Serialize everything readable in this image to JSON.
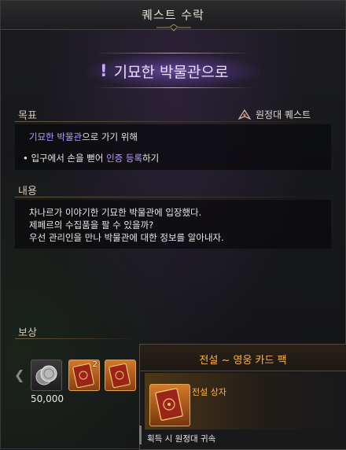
{
  "window": {
    "title": "퀘스트 수락"
  },
  "banner": {
    "title": "기묘한 박물관으로"
  },
  "objective": {
    "label": "목표",
    "quest_type": "원정대 퀘스트",
    "line1_hl": "기묘한 박물관",
    "line1_rest": "으로 가기 위해",
    "line2_pre": "입구에서 손을 뻗어 ",
    "line2_hl": "인증 등록",
    "line2_post": "하기"
  },
  "content": {
    "label": "내용",
    "lines": [
      "차나르가 이야기한 기묘한 박물관에 입장했다.",
      "제페르의 수집품을 팔 수 있을까?",
      "우선 관리인을 만나 박물관에 대한 정보를 알아내자."
    ]
  },
  "rewards": {
    "label": "보상",
    "amount": "50,000",
    "book_count": "2",
    "icons": [
      "silver-coin-icon",
      "card-pack-icon",
      "card-pack-icon"
    ]
  },
  "tooltip": {
    "title": "전설 ~ 영웅 카드 팩",
    "grade": "전설 상자",
    "bind_text": "획득 시 원정대 귀속"
  },
  "colors": {
    "highlight": "#b49cff",
    "legendary": "#ffb43a"
  }
}
